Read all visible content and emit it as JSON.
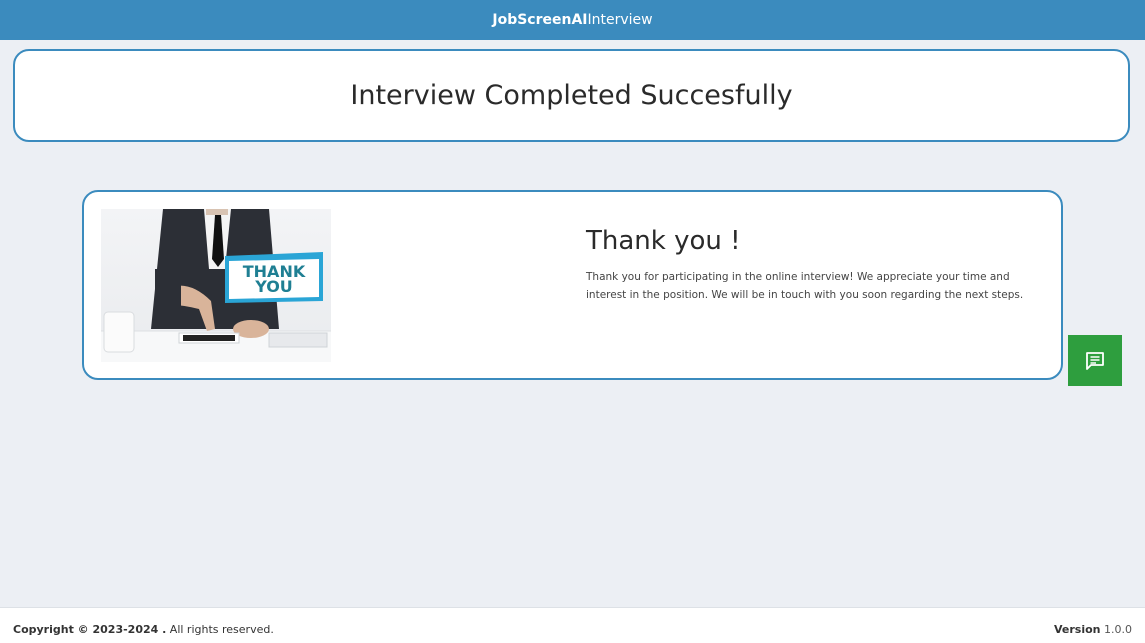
{
  "header": {
    "brand_bold": "JobScreenAI",
    "brand_regular": "Interview"
  },
  "title_card": {
    "title": "Interview Completed Succesfully"
  },
  "thanks_card": {
    "image_text_line1": "THANK",
    "image_text_line2": "YOU",
    "heading": "Thank you !",
    "message": "Thank you for participating in the online interview! We appreciate your time and interest in the position. We will be in touch with you soon regarding the next steps."
  },
  "chat_button": {
    "icon": "chat-icon",
    "color": "#2e9e3e"
  },
  "footer": {
    "copyright_bold": "Copyright © 2023-2024 .",
    "copyright_rest": " All rights reserved.",
    "version_label": "Version",
    "version_value": " 1.0.0"
  },
  "colors": {
    "accent": "#3b8bbe",
    "background": "#eceff4"
  }
}
